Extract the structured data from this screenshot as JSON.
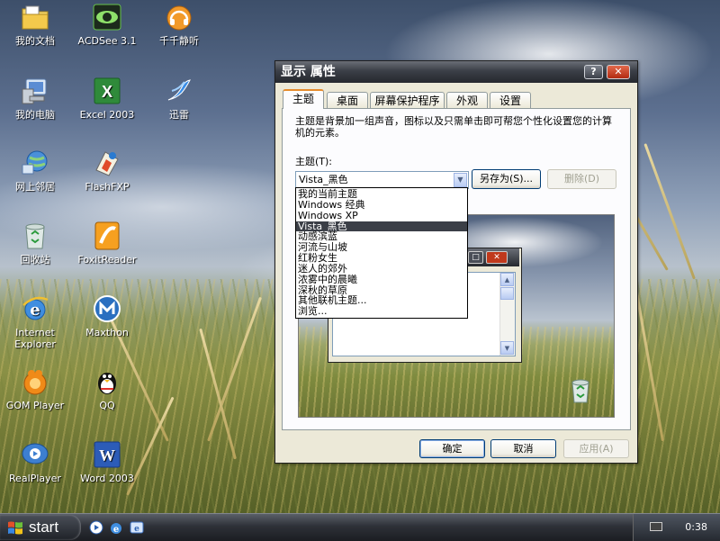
{
  "desktop": {
    "icons": [
      {
        "label": "我的文档",
        "icon": "folder-documents-icon"
      },
      {
        "label": "ACDSee 3.1",
        "icon": "acdsee-eye-icon"
      },
      {
        "label": "千千静听",
        "icon": "headphones-music-icon"
      },
      {
        "label": "我的电脑",
        "icon": "my-computer-icon"
      },
      {
        "label": "Excel 2003",
        "icon": "excel-icon"
      },
      {
        "label": "迅雷",
        "icon": "thunder-bird-icon"
      },
      {
        "label": "网上邻居",
        "icon": "network-places-icon"
      },
      {
        "label": "FlashFXP",
        "icon": "flashfxp-icon"
      },
      {
        "label": "回收站",
        "icon": "recycle-bin-icon"
      },
      {
        "label": "FoxitReader",
        "icon": "foxit-reader-icon"
      },
      {
        "label": "Internet Explorer",
        "icon": "internet-explorer-icon"
      },
      {
        "label": "Maxthon",
        "icon": "maxthon-icon"
      },
      {
        "label": "GOM Player",
        "icon": "gom-player-icon"
      },
      {
        "label": "QQ",
        "icon": "qq-penguin-icon"
      },
      {
        "label": "RealPlayer",
        "icon": "realplayer-icon"
      },
      {
        "label": "Word 2003",
        "icon": "word-icon"
      }
    ]
  },
  "dialog": {
    "title": "显示 属性",
    "help_btn": "?",
    "close_btn": "✕",
    "tabs": [
      "主题",
      "桌面",
      "屏幕保护程序",
      "外观",
      "设置"
    ],
    "active_tab": "主题",
    "description": "主题是背景加一组声音，图标以及只需单击即可帮您个性化设置您的计算机的元素。",
    "theme_label": "主题(T):",
    "theme_selected": "Vista_黑色",
    "saveas_label": "另存为(S)...",
    "delete_label": "删除(D)",
    "ok_label": "确定",
    "cancel_label": "取消",
    "apply_label": "应用(A)",
    "dropdown_options": [
      "我的当前主题",
      "Windows 经典",
      "Windows XP",
      "Vista_黑色",
      "动感滨蓝",
      "河流与山坡",
      "红粉女生",
      "迷人的郊外",
      "浓雾中的晨曦",
      "深秋的草原",
      "其他联机主题...",
      "浏览..."
    ],
    "highlighted_option": "Vista_黑色"
  },
  "taskbar": {
    "start_label": "start",
    "clock": "0:38",
    "quick_launch": [
      "media-player-icon",
      "internet-explorer-icon",
      "ie-alt-icon"
    ],
    "tray_icon": "keyboard-icon"
  },
  "colors": {
    "dialog_bg": "#ece9d8",
    "titlebar": "#3b3f47",
    "tab_highlight": "#e68b2c",
    "selection": "#3b3f47"
  }
}
